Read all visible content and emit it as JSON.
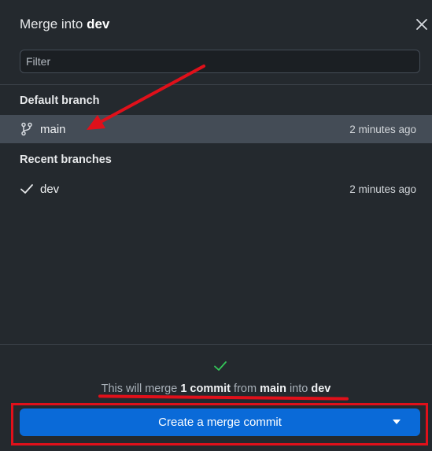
{
  "dialog": {
    "title_prefix": "Merge into",
    "title_branch": "dev"
  },
  "filter": {
    "placeholder": "Filter",
    "value": ""
  },
  "default_section": {
    "heading": "Default branch",
    "branch": {
      "name": "main",
      "time": "2 minutes ago",
      "icon": "branch-icon"
    }
  },
  "recent_section": {
    "heading": "Recent branches",
    "branch": {
      "name": "dev",
      "time": "2 minutes ago",
      "icon": "checkmark-icon"
    }
  },
  "summary": {
    "part1": "This will merge",
    "count": "1 commit",
    "part2": "from",
    "source": "main",
    "part3": "into",
    "target": "dev"
  },
  "merge_button": {
    "label": "Create a merge commit"
  },
  "colors": {
    "background": "#24292e",
    "selected_row": "#444c56",
    "button": "#0a6ad8",
    "success": "#34c759",
    "annotation": "#e0101a"
  }
}
